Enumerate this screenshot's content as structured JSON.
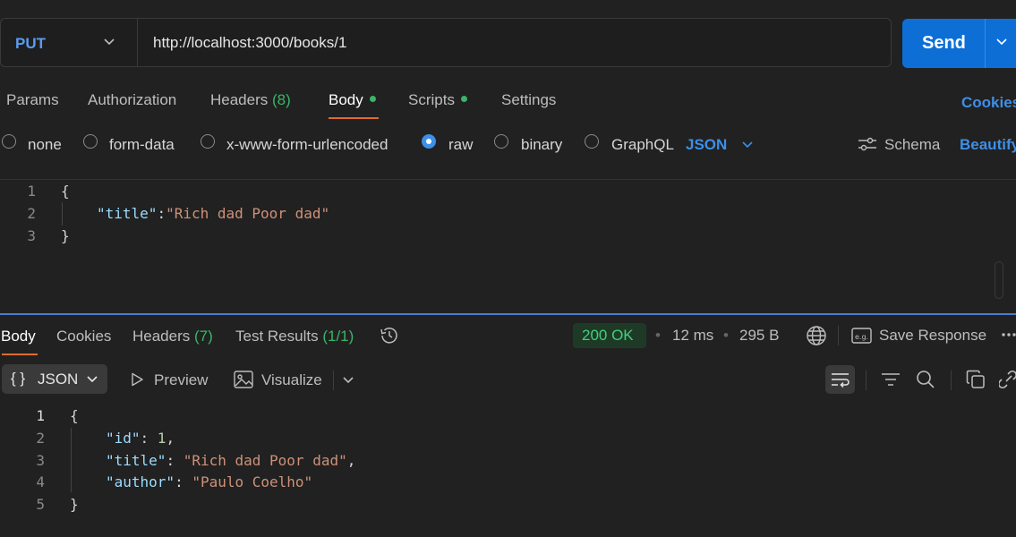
{
  "request": {
    "method": "PUT",
    "url": "http://localhost:3000/books/1",
    "send_label": "Send"
  },
  "request_tabs": {
    "params": "Params",
    "authorization": "Authorization",
    "headers": "Headers",
    "headers_count": "(8)",
    "body": "Body",
    "scripts": "Scripts",
    "settings": "Settings",
    "cookies": "Cookies"
  },
  "body_modes": {
    "none": "none",
    "form_data": "form-data",
    "urlencoded": "x-www-form-urlencoded",
    "raw": "raw",
    "binary": "binary",
    "graphql": "GraphQL",
    "selected": "raw",
    "language": "JSON",
    "schema": "Schema",
    "beautify": "Beautify"
  },
  "request_editor": {
    "line_numbers": [
      "1",
      "2",
      "3"
    ],
    "open_brace": "{",
    "key": "\"title\"",
    "colon": ":",
    "value": "\"Rich dad Poor dad\"",
    "close_brace": "}"
  },
  "response_tabs": {
    "body": "Body",
    "cookies": "Cookies",
    "headers": "Headers",
    "headers_count": "(7)",
    "test_results": "Test Results",
    "test_results_count": "(1/1)"
  },
  "response_meta": {
    "status": "200 OK",
    "time": "12 ms",
    "size": "295 B",
    "save_response": "Save Response"
  },
  "response_toolbar": {
    "format": "JSON",
    "preview": "Preview",
    "visualize": "Visualize"
  },
  "response_body": {
    "line_numbers": [
      "1",
      "2",
      "3",
      "4",
      "5"
    ],
    "open_brace": "{",
    "lines": [
      {
        "key": "\"id\"",
        "sep": ": ",
        "value": "1",
        "end": ","
      },
      {
        "key": "\"title\"",
        "sep": ": ",
        "value": "\"Rich dad Poor dad\"",
        "end": ","
      },
      {
        "key": "\"author\"",
        "sep": ": ",
        "value": "\"Paulo Coelho\"",
        "end": ""
      }
    ],
    "close_brace": "}"
  },
  "colors": {
    "accent": "#0d6fd6",
    "link": "#3d8fe8",
    "tab_underline": "#e06c2e",
    "success": "#3fd17c"
  }
}
